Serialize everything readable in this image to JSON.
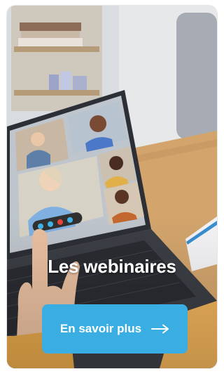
{
  "card": {
    "title": "Les webinaires",
    "cta_label": "En savoir plus",
    "cta_icon": "arrow-right-icon"
  },
  "colors": {
    "button": "#3aaee2",
    "title_text": "#ffffff"
  }
}
